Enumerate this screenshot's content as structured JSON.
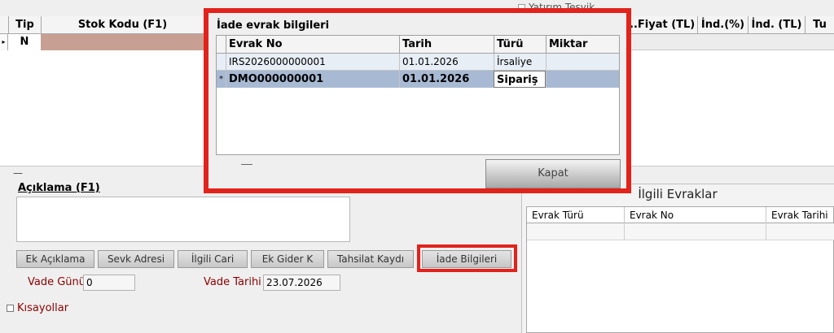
{
  "grid": {
    "columns": [
      {
        "label": "Tip"
      },
      {
        "label": "Stok Kodu (F1)"
      },
      {
        "label": "..Fiyat (TL)"
      },
      {
        "label": "İnd.(%)"
      },
      {
        "label": "İnd. (TL)"
      },
      {
        "label": "Tu"
      }
    ],
    "row": {
      "tip": "N"
    },
    "yatirim_label": "Yatırım Teşvik"
  },
  "aciklama": {
    "label": "Açıklama (F1)",
    "value": ""
  },
  "buttons": {
    "ek_aciklama": "Ek Açıklama",
    "sevk_adresi": "Sevk Adresi",
    "ilgili_cari": "İlgili Cari",
    "ek_gider": "Ek Gider K",
    "tahsilat_kaydi": "Tahsilat Kaydı",
    "iade_bilgileri": "İade Bilgileri"
  },
  "vade": {
    "gunu_label": "Vade Günü",
    "gunu_value": "0",
    "tarihi_label": "Vade Tarihi",
    "tarihi_value": "23.07.2026"
  },
  "kisayollar_label": "Kısayollar",
  "ilgili_evraklar": {
    "title": "İlgili Evraklar",
    "columns": [
      "Evrak Türü",
      "Evrak No",
      "Evrak Tarihi"
    ]
  },
  "iade_dialog": {
    "title": "İade evrak bilgileri",
    "columns": [
      "Evrak No",
      "Tarih",
      "Türü",
      "Miktar"
    ],
    "rows": [
      {
        "evrak_no": "IRS2026000000001",
        "tarih": "01.01.2026",
        "turu": "İrsaliye",
        "miktar": ""
      },
      {
        "evrak_no": "DMO000000001",
        "tarih": "01.01.2026",
        "turu": "Sipariş",
        "miktar": ""
      }
    ],
    "close_label": "Kapat"
  },
  "colors": {
    "highlight_red": "#e2221b",
    "label_red": "#8b0000",
    "selected_row": "#a8bad3"
  }
}
